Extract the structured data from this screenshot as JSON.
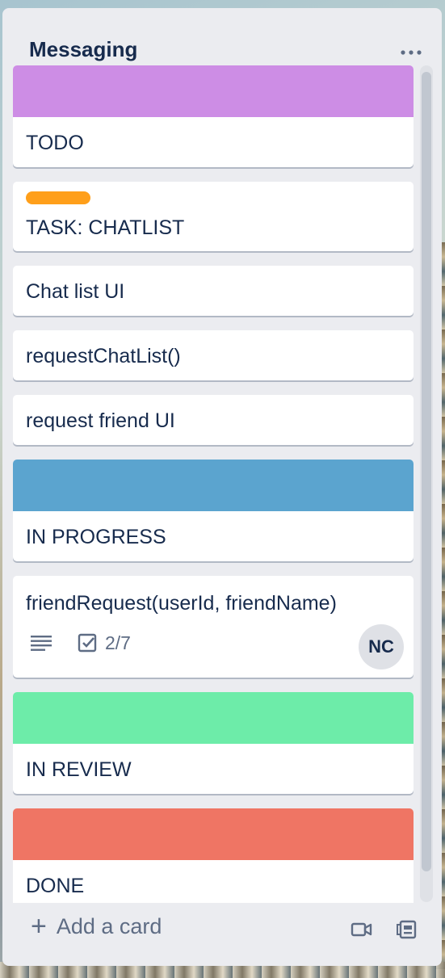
{
  "list": {
    "title": "Messaging",
    "more_label": "···"
  },
  "cards": [
    {
      "title": "TODO",
      "cover_color": "#cd8de5"
    },
    {
      "title": "TASK: CHATLIST",
      "label_color": "#ff9f1a"
    },
    {
      "title": "Chat list UI"
    },
    {
      "title": "requestChatList()"
    },
    {
      "title": "request friend UI"
    },
    {
      "title": "IN PROGRESS",
      "cover_color": "#5ba4cf"
    },
    {
      "title": "friendRequest(userId, friendName)",
      "checklist": "2/7",
      "member_initials": "NC"
    },
    {
      "title": "IN REVIEW",
      "cover_color": "#6deca9"
    },
    {
      "title": "DONE",
      "cover_color": "#ef7564"
    }
  ],
  "footer": {
    "add_card_icon": "+",
    "add_card_label": "Add a card",
    "icons": [
      "video-icon",
      "template-icon"
    ]
  },
  "colors": {
    "list_background": "#ebecf0",
    "text_primary": "#172b4d",
    "text_secondary": "#5e6c84"
  }
}
